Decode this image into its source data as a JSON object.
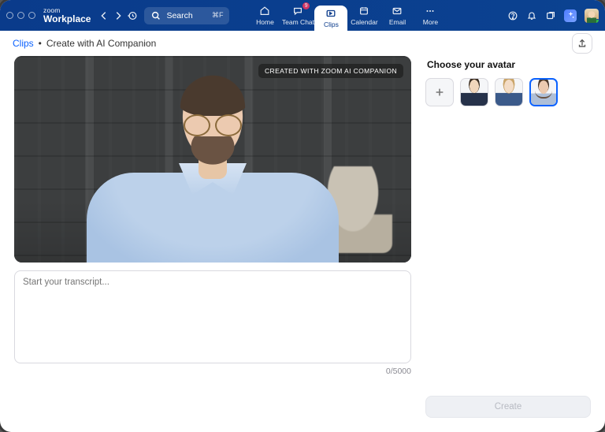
{
  "brand": {
    "top": "zoom",
    "bottom": "Workplace"
  },
  "search": {
    "placeholder": "Search",
    "shortcut": "⌘F"
  },
  "nav": {
    "items": [
      {
        "label": "Home"
      },
      {
        "label": "Team Chat",
        "badge": "9"
      },
      {
        "label": "Clips"
      },
      {
        "label": "Calendar"
      },
      {
        "label": "Email"
      },
      {
        "label": "More"
      }
    ],
    "active_index": 2
  },
  "breadcrumb": {
    "root": "Clips",
    "sep": "•",
    "current": "Create with AI Companion"
  },
  "preview": {
    "badge": "CREATED WITH ZOOM AI COMPANION"
  },
  "transcript": {
    "placeholder": "Start your transcript...",
    "value": "",
    "counter": "0/5000"
  },
  "right": {
    "title": "Choose your avatar",
    "avatars": [
      "avatar-1",
      "avatar-2",
      "avatar-3"
    ],
    "selected_index": 2,
    "create_label": "Create"
  }
}
